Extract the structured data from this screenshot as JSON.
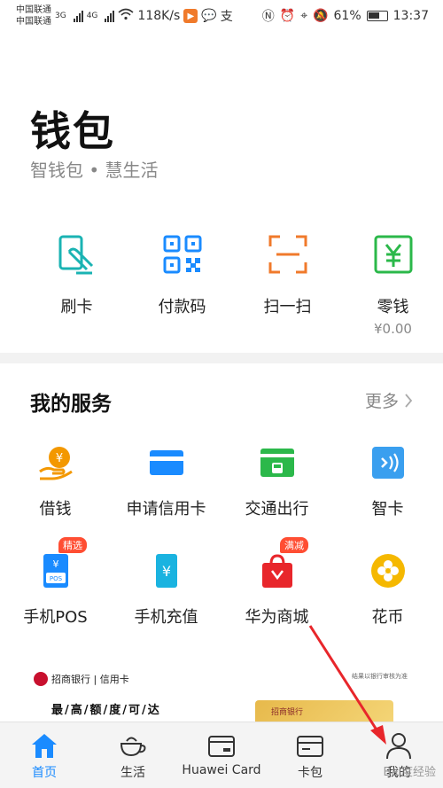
{
  "status_bar": {
    "carrier1": "中国联通",
    "carrier2": "中国联通",
    "net1": "3G",
    "net2": "4G",
    "speed": "118K/s",
    "battery": "61%",
    "time": "13:37"
  },
  "header": {
    "title": "钱包",
    "subtitle": "智钱包 • 慧生活"
  },
  "quick_actions": [
    {
      "label": "刷卡",
      "icon": "card-swipe-icon",
      "color": "#1ab3b3"
    },
    {
      "label": "付款码",
      "icon": "qr-code-icon",
      "color": "#1a8bff"
    },
    {
      "label": "扫一扫",
      "icon": "scan-icon",
      "color": "#f07a2b"
    },
    {
      "label": "零钱",
      "sub": "¥0.00",
      "icon": "change-wallet-icon",
      "color": "#2bb84a"
    }
  ],
  "services": {
    "title": "我的服务",
    "more": "更多",
    "items": [
      {
        "label": "借钱",
        "icon": "loan-icon",
        "color": "#f39800"
      },
      {
        "label": "申请信用卡",
        "icon": "credit-card-icon",
        "color": "#1a8bff"
      },
      {
        "label": "交通出行",
        "icon": "bus-card-icon",
        "color": "#2bb84a"
      },
      {
        "label": "智卡",
        "icon": "nfc-card-icon",
        "color": "#3a9fef"
      },
      {
        "label": "手机POS",
        "icon": "pos-icon",
        "color": "#1a8bff",
        "badge": "精选"
      },
      {
        "label": "手机充值",
        "icon": "phone-topup-icon",
        "color": "#1ab3e0"
      },
      {
        "label": "华为商城",
        "icon": "shopping-bag-icon",
        "color": "#e8262b",
        "badge": "满减"
      },
      {
        "label": "花币",
        "icon": "flower-coin-icon",
        "color": "#f5b800"
      }
    ]
  },
  "banner": {
    "bank_name": "招商银行 | 信用卡",
    "headline": "最/高/额/度/可/达",
    "note": "结果以银行审核为准",
    "card_text": "招商银行"
  },
  "tabs": [
    {
      "label": "首页",
      "icon": "home-icon",
      "active": true
    },
    {
      "label": "生活",
      "icon": "coffee-cup-icon",
      "active": false
    },
    {
      "label": "Huawei Card",
      "icon": "huawei-card-icon",
      "active": false
    },
    {
      "label": "卡包",
      "icon": "card-wallet-icon",
      "active": false
    },
    {
      "label": "我的",
      "icon": "person-icon",
      "active": false
    }
  ],
  "watermark": "Bai度经验",
  "colors": {
    "accent": "#1a8bff",
    "annotation_arrow": "#e8262b"
  }
}
